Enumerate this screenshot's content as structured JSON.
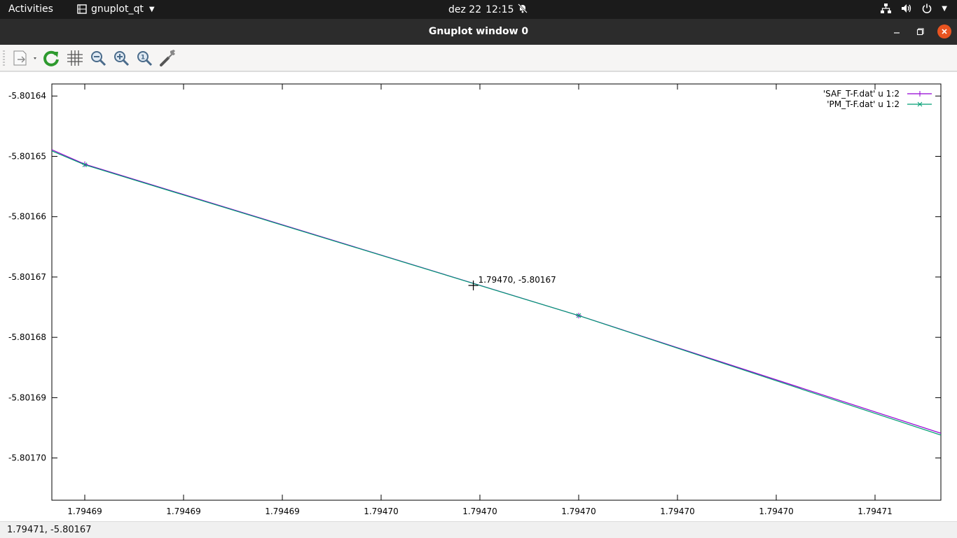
{
  "topbar": {
    "activities": "Activities",
    "app_name": "gnuplot_qt",
    "date": "dez 22",
    "time": "12:15"
  },
  "window": {
    "title": "Gnuplot window 0"
  },
  "toolbar": {
    "tools": [
      "export-icon",
      "replot-icon",
      "grid-icon",
      "zoom-previous-icon",
      "zoom-next-icon",
      "autoscale-icon",
      "settings-icon"
    ]
  },
  "status": {
    "coordinates": "1.79471, -5.80167"
  },
  "chart_data": {
    "type": "line",
    "xlim": [
      1.794685,
      1.794712
    ],
    "ylim": [
      -5.801707,
      -5.801638
    ],
    "x_ticks": [
      {
        "value": 1.794686,
        "label": "1.79469"
      },
      {
        "value": 1.794689,
        "label": "1.79469"
      },
      {
        "value": 1.794692,
        "label": "1.79469"
      },
      {
        "value": 1.794695,
        "label": "1.79470"
      },
      {
        "value": 1.794698,
        "label": "1.79470"
      },
      {
        "value": 1.794701,
        "label": "1.79470"
      },
      {
        "value": 1.794704,
        "label": "1.79470"
      },
      {
        "value": 1.794707,
        "label": "1.79470"
      },
      {
        "value": 1.79471,
        "label": "1.79471"
      }
    ],
    "y_ticks": [
      {
        "value": -5.80164,
        "label": "-5.80164"
      },
      {
        "value": -5.80165,
        "label": "-5.80165"
      },
      {
        "value": -5.80166,
        "label": "-5.80166"
      },
      {
        "value": -5.80167,
        "label": "-5.80167"
      },
      {
        "value": -5.80168,
        "label": "-5.80168"
      },
      {
        "value": -5.80169,
        "label": "-5.80169"
      },
      {
        "value": -5.8017,
        "label": "-5.80170"
      }
    ],
    "series": [
      {
        "name": "'SAF_T-F.dat' u 1:2",
        "color": "#9400d3",
        "marker": "plus",
        "x": [
          1.794685,
          1.794686,
          1.794701,
          1.794712
        ],
        "y": [
          -5.8016489,
          -5.8016513,
          -5.8016764,
          -5.8016959
        ]
      },
      {
        "name": "'PM_T-F.dat' u 1:2",
        "color": "#009e73",
        "marker": "cross",
        "x": [
          1.794685,
          1.794686,
          1.794701,
          1.794712
        ],
        "y": [
          -5.8016491,
          -5.8016514,
          -5.8016764,
          -5.8016962
        ]
      }
    ],
    "legend": "top-right",
    "annotation": {
      "text": "1.79470, -5.80167",
      "x": 1.7946978,
      "y": -5.8016714
    },
    "grid": false
  }
}
